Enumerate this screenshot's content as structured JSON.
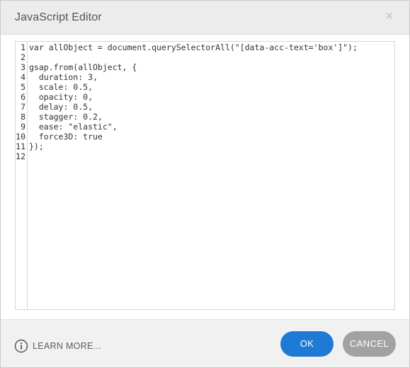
{
  "dialog": {
    "title": "JavaScript Editor",
    "close_glyph": "×"
  },
  "editor": {
    "lines": [
      {
        "num": "1",
        "text": "var allObject = document.querySelectorAll(\"[data-acc-text='box']\");"
      },
      {
        "num": "2",
        "text": ""
      },
      {
        "num": "3",
        "text": "gsap.from(allObject, {"
      },
      {
        "num": "4",
        "text": "  duration: 3,"
      },
      {
        "num": "5",
        "text": "  scale: 0.5,"
      },
      {
        "num": "6",
        "text": "  opacity: 0,"
      },
      {
        "num": "7",
        "text": "  delay: 0.5,"
      },
      {
        "num": "8",
        "text": "  stagger: 0.2,"
      },
      {
        "num": "9",
        "text": "  ease: \"elastic\","
      },
      {
        "num": "10",
        "text": "  force3D: true"
      },
      {
        "num": "11",
        "text": "});"
      },
      {
        "num": "12",
        "text": ""
      }
    ]
  },
  "footer": {
    "learn_more_label": "LEARN MORE...",
    "ok_label": "OK",
    "cancel_label": "CANCEL"
  },
  "colors": {
    "ok_button": "#1f7ad6",
    "cancel_button": "#a2a2a2",
    "keyword": "#8a8a3a",
    "string": "#5a5aa0",
    "number": "#2d7a2d"
  },
  "icons": {
    "close": "close-icon",
    "info": "info-icon"
  }
}
